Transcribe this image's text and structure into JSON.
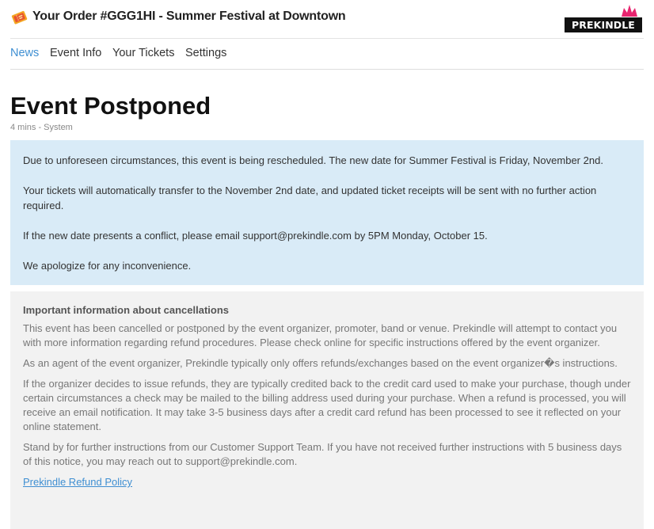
{
  "header": {
    "title": "Your Order #GGG1HI - Summer Festival at Downtown",
    "logo_text": "PREKINDLE"
  },
  "nav": {
    "items": [
      {
        "label": "News",
        "active": true
      },
      {
        "label": "Event Info",
        "active": false
      },
      {
        "label": "Your Tickets",
        "active": false
      },
      {
        "label": "Settings",
        "active": false
      }
    ]
  },
  "post": {
    "title": "Event Postponed",
    "meta": "4 mins - System",
    "paragraphs": [
      "Due to unforeseen circumstances, this event is being rescheduled. The new date for Summer Festival is Friday, November 2nd.",
      "Your tickets will automatically transfer to the November 2nd date, and updated ticket receipts will be sent with no further action required.",
      "If the new date presents a conflict, please email support@prekindle.com by 5PM Monday, October 15.",
      "We apologize for any inconvenience."
    ]
  },
  "cancellation_info": {
    "heading": "Important information about cancellations",
    "paragraphs": [
      "This event has been cancelled or postponed by the event organizer, promoter, band or venue. Prekindle will attempt to contact you with more information regarding refund procedures. Please check online for specific instructions offered by the event organizer.",
      "As an agent of the event organizer, Prekindle typically only offers refunds/exchanges based on the event organizer�s instructions.",
      "If the organizer decides to issue refunds, they are typically credited back to the credit card used to make your purchase, though under certain circumstances a check may be mailed to the billing address used during your purchase. When a refund is processed, you will receive an email notification. It may take 3-5 business days after a credit card refund has been processed to see it reflected on your online statement.",
      "Stand by for further instructions from our Customer Support Team. If you have not received further instructions with 5 business days of this notice, you may reach out to support@prekindle.com."
    ],
    "link_label": "Prekindle Refund Policy"
  },
  "colors": {
    "accent": "#3f8fd2",
    "notice_bg": "#d9ebf7",
    "info_bg": "#f2f2f2",
    "brand_pink": "#e8246f"
  },
  "icons": [
    "ticket-icon",
    "prekindle-logo",
    "crown-icon"
  ]
}
